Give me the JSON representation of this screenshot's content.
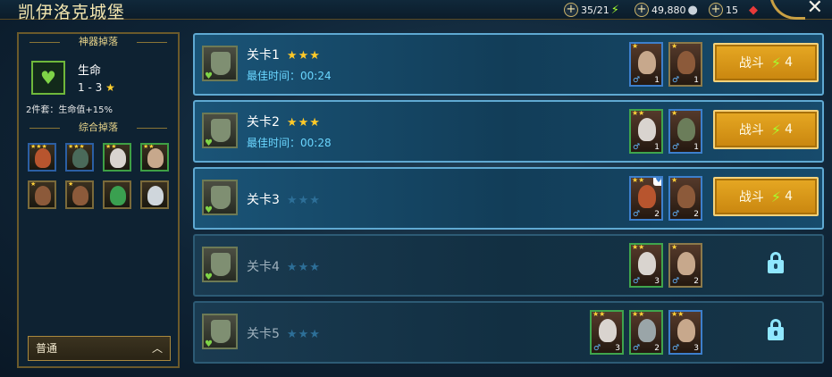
{
  "header": {
    "title": "凯伊洛克城堡",
    "energy": "35/21",
    "silver": "49,880",
    "gems": "15"
  },
  "sidebar": {
    "artifact_heading": "神器掉落",
    "artifact_name": "生命",
    "artifact_level": "1 - 3",
    "set_bonus": "2件套：生命值+15%",
    "drops_heading": "综合掉落",
    "mode_label": "普通"
  },
  "stages": [
    {
      "name": "关卡1",
      "stars": 3,
      "best": "最佳时间：00:24",
      "locked": false,
      "battle_label": "战斗",
      "cost": "4",
      "heroes": [
        {
          "lvl": "1",
          "stars": "★",
          "border": "blue",
          "tone": "#c7a88c"
        },
        {
          "lvl": "1",
          "stars": "★",
          "border": "gold",
          "tone": "#8c5a3a"
        }
      ]
    },
    {
      "name": "关卡2",
      "stars": 3,
      "best": "最佳时间：00:28",
      "locked": false,
      "battle_label": "战斗",
      "cost": "4",
      "heroes": [
        {
          "lvl": "1",
          "stars": "★★",
          "border": "green",
          "tone": "#d9d4cf"
        },
        {
          "lvl": "1",
          "stars": "★",
          "border": "blue",
          "tone": "#6b7d5a"
        }
      ]
    },
    {
      "name": "关卡3",
      "stars": 0,
      "best": "",
      "locked": false,
      "battle_label": "战斗",
      "cost": "4",
      "heroes": [
        {
          "lvl": "2",
          "stars": "★★",
          "border": "blue",
          "tone": "#b8552e"
        },
        {
          "lvl": "2",
          "stars": "★",
          "border": "blue",
          "tone": "#8c5a3a"
        }
      ]
    },
    {
      "name": "关卡4",
      "stars": 0,
      "best": "",
      "locked": true,
      "heroes": [
        {
          "lvl": "3",
          "stars": "★★",
          "border": "green",
          "tone": "#d9d4cf"
        },
        {
          "lvl": "2",
          "stars": "★",
          "border": "gold",
          "tone": "#c7a88c"
        }
      ]
    },
    {
      "name": "关卡5",
      "stars": 0,
      "best": "",
      "locked": true,
      "heroes": [
        {
          "lvl": "3",
          "stars": "★★",
          "border": "green",
          "tone": "#d9d4cf"
        },
        {
          "lvl": "2",
          "stars": "★★",
          "border": "green",
          "tone": "#9aa5a8"
        },
        {
          "lvl": "3",
          "stars": "★★",
          "border": "blue",
          "tone": "#c7a88c"
        }
      ]
    }
  ],
  "drop_items": [
    {
      "name": "hero-drop-1",
      "stars": "★★★",
      "border": "blue",
      "tone": "#b8552e"
    },
    {
      "name": "shield-drop",
      "stars": "★★★",
      "border": "blue",
      "tone": "#4a6a5a"
    },
    {
      "name": "hero-drop-2",
      "stars": "★★",
      "border": "green",
      "tone": "#d9d4cf"
    },
    {
      "name": "hero-drop-3",
      "stars": "★★",
      "border": "green",
      "tone": "#c7a88c"
    },
    {
      "name": "hero-drop-4",
      "stars": "★",
      "border": "gold",
      "tone": "#8c5a3a"
    },
    {
      "name": "hero-drop-5",
      "stars": "★",
      "border": "gold",
      "tone": "#8c5a3a"
    },
    {
      "name": "gem-drop",
      "stars": "",
      "border": "gold",
      "tone": "#3aa050"
    },
    {
      "name": "coin-drop",
      "stars": "",
      "border": "gold",
      "tone": "#cfd6dc"
    }
  ],
  "colors": {
    "accent_gold": "#e6a823",
    "lock": "#8fe7ff",
    "star_on": "#ffc928",
    "star_off": "#2d6f98"
  }
}
